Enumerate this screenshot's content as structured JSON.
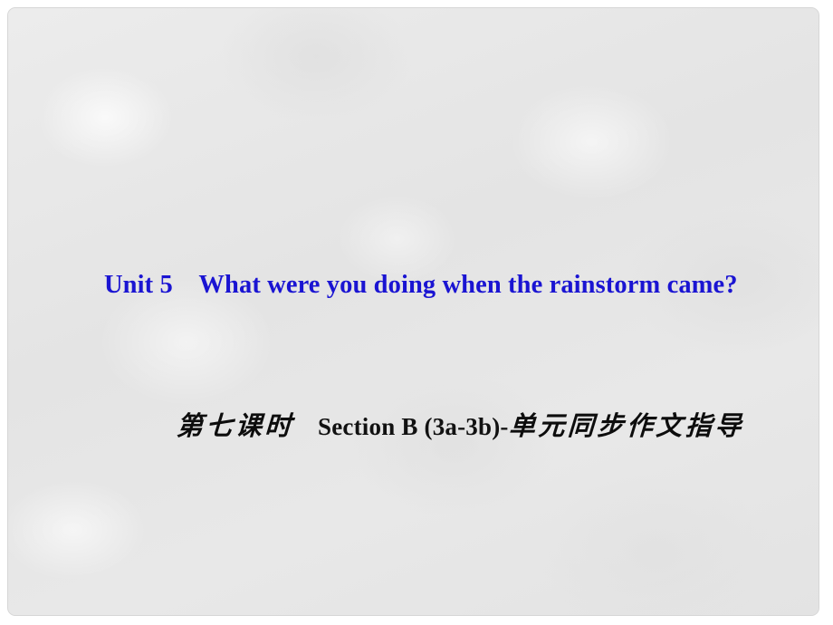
{
  "slide": {
    "background_color": "#e7e7e7",
    "border_color": "#d6d6d6",
    "page_color": "#ffffff",
    "title": {
      "line1": {
        "text": "Unit 5　What were you doing when the rainstorm came?",
        "unit_label": "Unit 5",
        "question": "What were you doing when the rainstorm came?",
        "color": "#1a14d2"
      },
      "line2": {
        "text": "第七课时　Section B (3a-3b)-单元同步作文指导",
        "lesson_label": "第七课时",
        "section_label": "Section B (3a-3b)-",
        "topic_label": "单元同步作文指导",
        "color": "#111111"
      }
    }
  }
}
